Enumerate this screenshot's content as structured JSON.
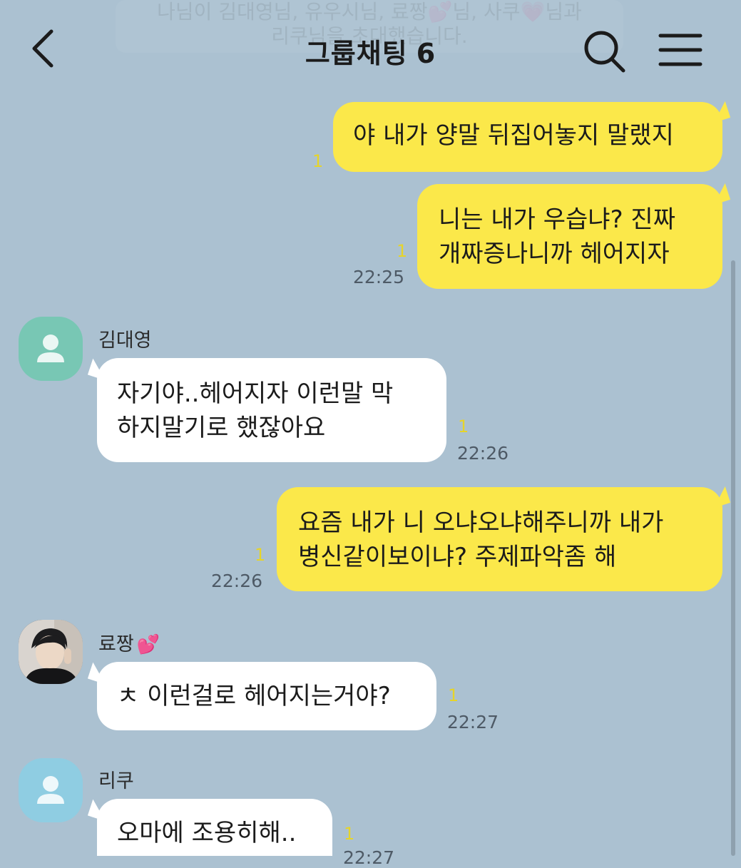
{
  "header": {
    "title": "그룹채팅",
    "member_count": "6",
    "notice_line1": "나님이 김대영님, 유우시님, 료짱💕님, 사쿠💗님과",
    "notice_line2": "리쿠님을 초대했습니다."
  },
  "messages": [
    {
      "kind": "mine",
      "lines": [
        "야 내가 양말 뒤집어놓지 말랬지"
      ],
      "unread": "1",
      "time": ""
    },
    {
      "kind": "mine",
      "lines": [
        "니는 내가 우습냐? 진짜",
        "개짜증나니까 헤어지자"
      ],
      "unread": "1",
      "time": "22:25"
    },
    {
      "kind": "theirs",
      "sender": "김대영",
      "lines": [
        "자기야..헤어지자 이런말 막",
        "하지말기로 했잖아요"
      ],
      "unread": "1",
      "time": "22:26"
    },
    {
      "kind": "mine",
      "lines": [
        "요즘 내가 니 오냐오냐해주니까 내가",
        "병신같이보이냐? 주제파악좀 해"
      ],
      "unread": "1",
      "time": "22:26"
    },
    {
      "kind": "theirs",
      "sender": "료짱",
      "sender_emoji": "💕",
      "lines": [
        "ㅊ 이런걸로 헤어지는거야?"
      ],
      "unread": "1",
      "time": "22:27"
    },
    {
      "kind": "theirs",
      "sender": "리쿠",
      "lines": [
        "오마에 조용히해.."
      ],
      "unread": "1",
      "time": "22:27"
    }
  ],
  "icons": {
    "back": "back-arrow-icon",
    "search": "search-icon",
    "menu": "menu-icon",
    "avatar_default": "person-icon"
  },
  "colors": {
    "background": "#abc1d1",
    "my_bubble": "#fbe84a",
    "their_bubble": "#ffffff",
    "unread": "#e6d42a"
  }
}
